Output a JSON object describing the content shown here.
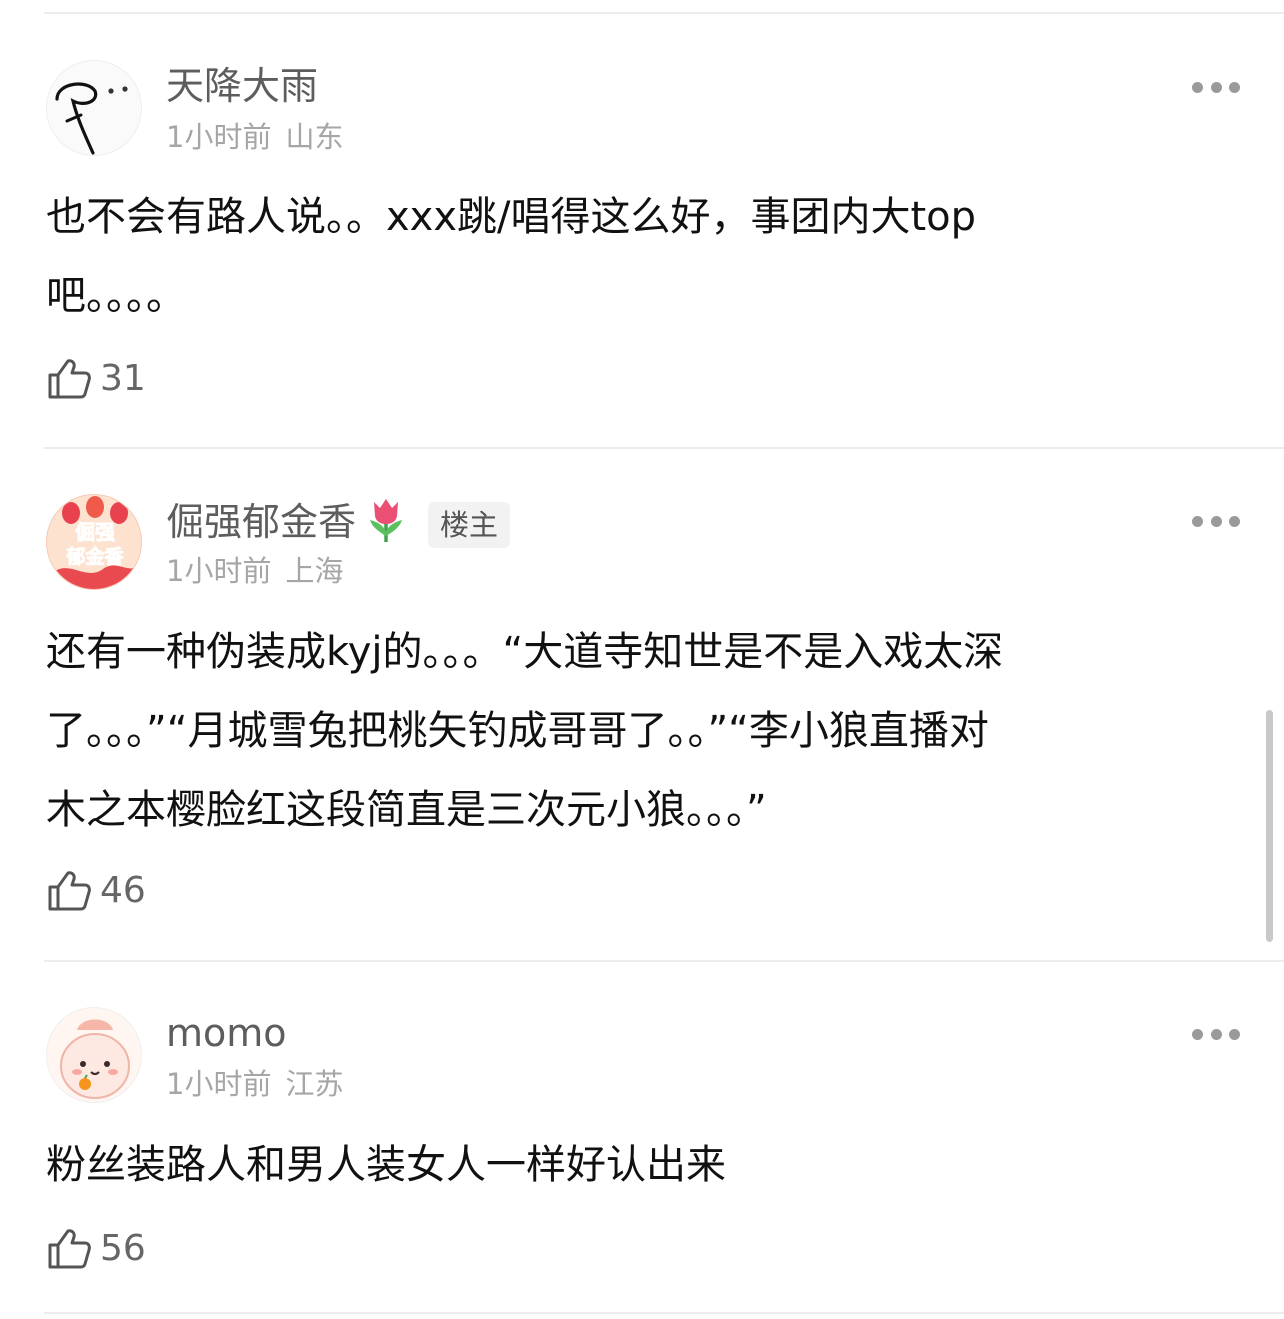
{
  "comments": [
    {
      "username": "天降大雨",
      "time": "1小时前",
      "location": "山东",
      "text": "也不会有路人说。。xxx跳/唱得这么好，事团内大top\n吧。。。。",
      "likes": "31",
      "avatar_icon": "hand-drawn-sketch-avatar"
    },
    {
      "username": "倔强郁金香",
      "emoji": "🌷",
      "badge": "楼主",
      "time": "1小时前",
      "location": "上海",
      "text": "还有一种伪装成kyj的。。。“大道寺知世是不是入戏太深\n了。。。”“月城雪兔把桃矢钓成哥哥了。。”“李小狼直播对\n木之本樱脸红这段简直是三次元小狼。。。”",
      "likes": "46",
      "avatar_icon": "tulip-text-avatar",
      "avatar_text": [
        "倔强",
        "郁金香"
      ]
    },
    {
      "username": "momo",
      "time": "1小时前",
      "location": "江苏",
      "text": "粉丝装路人和男人装女人一样好认出来",
      "likes": "56",
      "avatar_icon": "cute-character-avatar"
    }
  ],
  "colors": {
    "username": "#5d5d5d",
    "meta": "#a6a6a6",
    "text": "#111111",
    "divider": "#ececec",
    "badge_bg": "#f2f2f2"
  }
}
